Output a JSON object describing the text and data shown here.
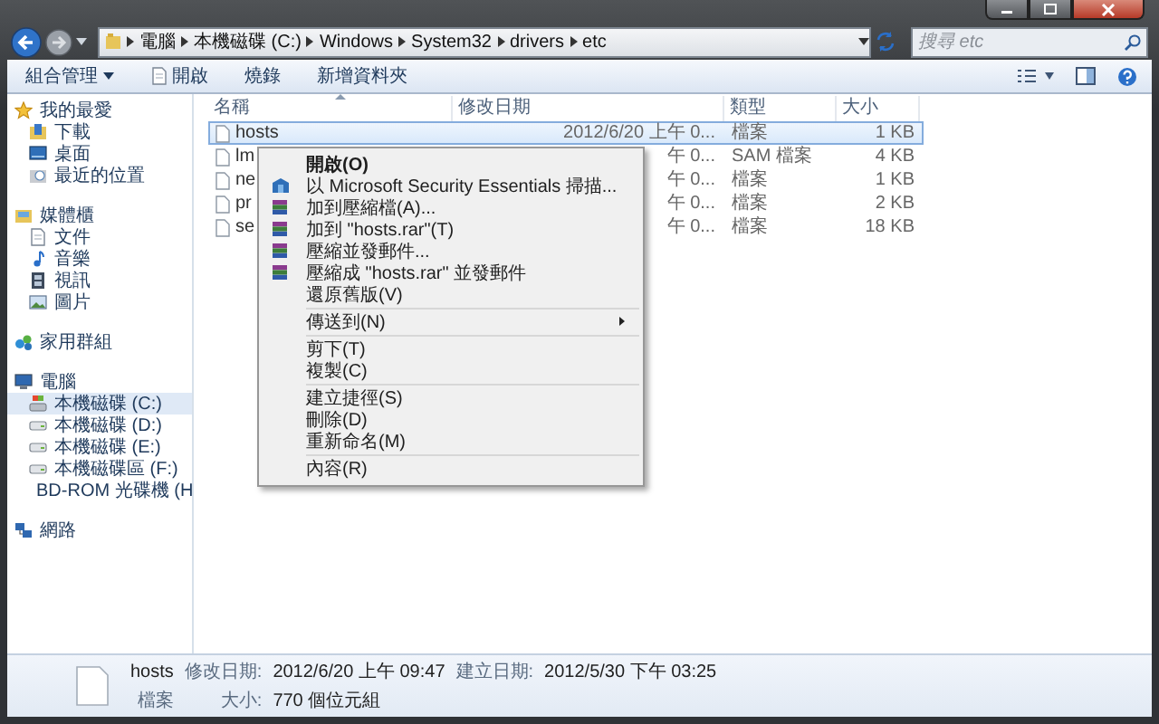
{
  "address_bar": {
    "path": [
      "電腦",
      "本機磁碟 (C:)",
      "Windows",
      "System32",
      "drivers",
      "etc"
    ]
  },
  "search": {
    "placeholder": "搜尋 etc"
  },
  "toolbar": {
    "buttons": [
      {
        "label": "組合管理",
        "kind": "menu"
      },
      {
        "label": "開啟",
        "kind": "document"
      },
      {
        "label": "燒錄",
        "kind": "plain"
      },
      {
        "label": "新增資料夾",
        "kind": "plain"
      }
    ]
  },
  "sidebar": {
    "groups": [
      {
        "label": "我的最愛",
        "kind": "star",
        "selected": false,
        "children": [
          {
            "label": "下載",
            "kind": "download",
            "selected": false
          },
          {
            "label": "桌面",
            "kind": "desktop",
            "selected": false
          },
          {
            "label": "最近的位置",
            "kind": "recent",
            "selected": false
          }
        ]
      },
      {
        "label": "媒體櫃",
        "kind": "library",
        "selected": false,
        "children": [
          {
            "label": "文件",
            "kind": "document",
            "selected": false
          },
          {
            "label": "音樂",
            "kind": "music",
            "selected": false
          },
          {
            "label": "視訊",
            "kind": "video",
            "selected": false
          },
          {
            "label": "圖片",
            "kind": "picture",
            "selected": false
          }
        ]
      },
      {
        "label": "家用群組",
        "kind": "homegroup",
        "selected": false
      },
      {
        "label": "電腦",
        "kind": "computer",
        "selected": false,
        "children": [
          {
            "label": "本機磁碟 (C:)",
            "kind": "system-drive",
            "selected": true
          },
          {
            "label": "本機磁碟 (D:)",
            "kind": "drive",
            "selected": false
          },
          {
            "label": "本機磁碟 (E:)",
            "kind": "drive",
            "selected": false
          },
          {
            "label": "本機磁碟區 (F:)",
            "kind": "drive",
            "selected": false
          },
          {
            "label": "BD-ROM 光碟機 (H",
            "kind": "disc",
            "selected": false
          }
        ]
      },
      {
        "label": "網路",
        "kind": "network",
        "selected": false
      }
    ]
  },
  "table": {
    "columns": [
      "名稱",
      "修改日期",
      "類型",
      "大小"
    ],
    "rows": [
      {
        "name": "hosts",
        "date": "2012/6/20 上午 0...",
        "type": "檔案",
        "size": "1 KB",
        "selected": true
      },
      {
        "name": "lm",
        "date": "午 0...",
        "type": "SAM 檔案",
        "size": "4 KB",
        "selected": false
      },
      {
        "name": "ne",
        "date": "午 0...",
        "type": "檔案",
        "size": "1 KB",
        "selected": false
      },
      {
        "name": "pr",
        "date": "午 0...",
        "type": "檔案",
        "size": "2 KB",
        "selected": false
      },
      {
        "name": "se",
        "date": "午 0...",
        "type": "檔案",
        "size": "18 KB",
        "selected": false
      }
    ]
  },
  "context_menu": {
    "sections": [
      [
        {
          "label": "開啟(O)",
          "kind": "plain",
          "default": true,
          "submenu": false
        },
        {
          "label": "以 Microsoft Security Essentials 掃描...",
          "kind": "scan",
          "default": false,
          "submenu": false
        },
        {
          "label": "加到壓縮檔(A)...",
          "kind": "archive",
          "default": false,
          "submenu": false
        },
        {
          "label": "加到 \"hosts.rar\"(T)",
          "kind": "archive",
          "default": false,
          "submenu": false
        },
        {
          "label": "壓縮並發郵件...",
          "kind": "archive",
          "default": false,
          "submenu": false
        },
        {
          "label": "壓縮成 \"hosts.rar\" 並發郵件",
          "kind": "archive",
          "default": false,
          "submenu": false
        },
        {
          "label": "還原舊版(V)",
          "kind": "plain",
          "default": false,
          "submenu": false
        }
      ],
      [
        {
          "label": "傳送到(N)",
          "kind": "plain",
          "default": false,
          "submenu": true
        }
      ],
      [
        {
          "label": "剪下(T)",
          "kind": "plain",
          "default": false,
          "submenu": false
        },
        {
          "label": "複製(C)",
          "kind": "plain",
          "default": false,
          "submenu": false
        }
      ],
      [
        {
          "label": "建立捷徑(S)",
          "kind": "plain",
          "default": false,
          "submenu": false
        },
        {
          "label": "刪除(D)",
          "kind": "plain",
          "default": false,
          "submenu": false
        },
        {
          "label": "重新命名(M)",
          "kind": "plain",
          "default": false,
          "submenu": false
        }
      ],
      [
        {
          "label": "內容(R)",
          "kind": "plain",
          "default": false,
          "submenu": false
        }
      ]
    ]
  },
  "details": {
    "name": "hosts",
    "type": "檔案",
    "fields": [
      {
        "label": "修改日期:",
        "value": "2012/6/20 上午 09:47"
      },
      {
        "label": "建立日期:",
        "value": "2012/5/30 下午 03:25"
      },
      {
        "label": "大小:",
        "value": "770 個位元組"
      }
    ]
  }
}
